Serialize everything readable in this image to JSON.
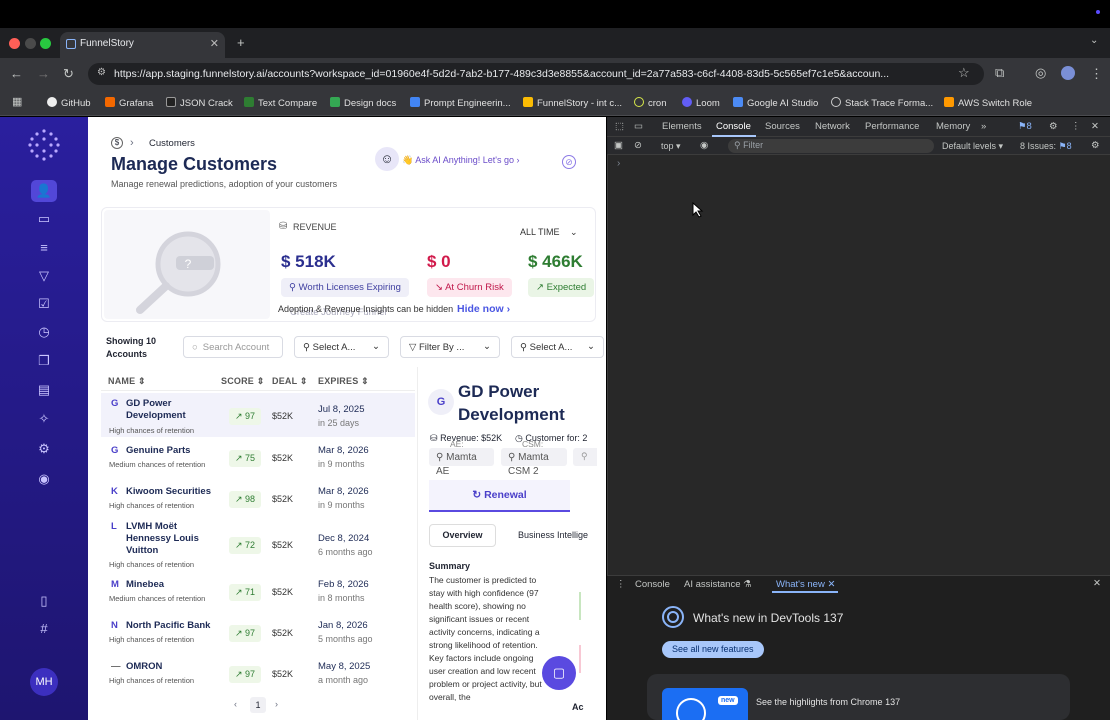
{
  "browser": {
    "tab_title": "FunnelStory",
    "url": "https://app.staging.funnelstory.ai/accounts?workspace_id=01960e4f-5d2d-7ab2-b177-489c3d3e8855&account_id=2a77a583-c6cf-4408-83d5-5c565ef7c1e5&accoun...",
    "bookmarks": [
      "GitHub",
      "Grafana",
      "JSON Crack",
      "Text Compare",
      "Design docs",
      "Prompt Engineerin...",
      "FunnelStory - int c...",
      "cron",
      "Loom",
      "Google AI Studio",
      "Stack Trace Forma...",
      "AWS Switch Role"
    ]
  },
  "sidebar": {
    "avatar": "MH"
  },
  "header": {
    "breadcrumb": "Customers",
    "title": "Manage Customers",
    "subtitle": "Manage renewal predictions, adoption of your customers",
    "ask_ai": "👋 Ask AI Anything! Let's go"
  },
  "revenue": {
    "label": "REVENUE",
    "period": "ALL TIME",
    "stats": [
      {
        "value": "$ 518K",
        "label": "Worth Licenses Expiring",
        "color": "#2b2f8f"
      },
      {
        "value": "$ 0",
        "label": "At Churn Risk",
        "color": "#d11a4b"
      },
      {
        "value": "$ 466K",
        "label": "Expected",
        "color": "#2e7d32"
      }
    ],
    "insights_note": "Adoption & Revenue Insights can be hidden",
    "overlap_text": "Create Journey Funnel",
    "hide_now": "Hide now"
  },
  "filters": {
    "showing": "Showing 10 Accounts",
    "search_placeholder": "Search Account",
    "select1": "Select A...",
    "filter_by": "Filter By ...",
    "select2": "Select A..."
  },
  "table": {
    "headers": [
      "NAME",
      "SCORE",
      "DEAL",
      "EXPIRES"
    ],
    "rows": [
      {
        "initial": "G",
        "name": "GD Power Development",
        "chance": "High chances of retention",
        "score": "97",
        "deal": "$52K",
        "expires": "Jul 8, 2025",
        "ago": "in 25 days"
      },
      {
        "initial": "G",
        "name": "Genuine Parts",
        "chance": "Medium chances of retention",
        "score": "75",
        "deal": "$52K",
        "expires": "Mar 8, 2026",
        "ago": "in 9 months"
      },
      {
        "initial": "K",
        "name": "Kiwoom Securities",
        "chance": "High chances of retention",
        "score": "98",
        "deal": "$52K",
        "expires": "Mar 8, 2026",
        "ago": "in 9 months"
      },
      {
        "initial": "L",
        "name": "LVMH Moët Hennessy Louis Vuitton",
        "chance": "High chances of retention",
        "score": "72",
        "deal": "$52K",
        "expires": "Dec 8, 2024",
        "ago": "6 months ago"
      },
      {
        "initial": "M",
        "name": "Minebea",
        "chance": "Medium chances of retention",
        "score": "71",
        "deal": "$52K",
        "expires": "Feb 8, 2026",
        "ago": "in 8 months"
      },
      {
        "initial": "N",
        "name": "North Pacific Bank",
        "chance": "High chances of retention",
        "score": "97",
        "deal": "$52K",
        "expires": "Jan 8, 2026",
        "ago": "5 months ago"
      },
      {
        "initial": "—",
        "name": "OMRON",
        "chance": "High chances of retention",
        "score": "97",
        "deal": "$52K",
        "expires": "May 8, 2025",
        "ago": "a month ago"
      }
    ],
    "page": "1"
  },
  "detail": {
    "initial": "G",
    "name": "GD Power Development",
    "revenue": "Revenue: $52K",
    "customer_for": "Customer for: 2",
    "ae_label": "AE:",
    "csm_label": "CSM:",
    "ae_name": "Mamta AE",
    "csm_name": "Mamta CSM 2",
    "renewal": "Renewal",
    "tab_overview": "Overview",
    "tab_bi": "Business Intellige",
    "summary_title": "Summary",
    "summary": "The customer is predicted to stay with high confidence (97 health score), showing no significant issues or recent activity concerns, indicating a strong likelihood of retention. Key factors include ongoing user creation and low recent problem or project activity, but overall, the",
    "ac": "Ac"
  },
  "devtools": {
    "tabs": [
      "Elements",
      "Console",
      "Sources",
      "Network",
      "Performance",
      "Memory"
    ],
    "issues_badge": "8",
    "context": "top",
    "filter_placeholder": "Filter",
    "levels": "Default levels",
    "issues": "8 Issues:",
    "issues_count": "8",
    "drawer_tabs": [
      "Console",
      "AI assistance",
      "What's new"
    ],
    "whats_new_title": "What's new in DevTools 137",
    "see_all": "See all new features",
    "highlights": "See the highlights from Chrome 137",
    "new_badge": "new"
  }
}
